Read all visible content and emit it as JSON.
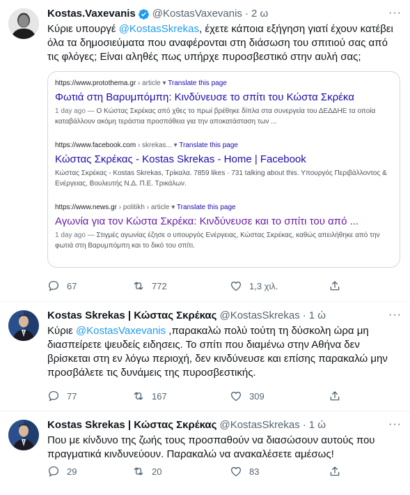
{
  "tweets": [
    {
      "name": "Kostas.Vaxevanis",
      "handle": "@KostasVaxevanis",
      "dot": "·",
      "time": "2 ω",
      "text_before": "Κύριε υπουργέ ",
      "mention": "@KostasSkrekas",
      "text_after": ", έχετε κάποια εξήγηση γιατί έχουν κατέβει όλα τα δημοσιεύματα που αναφέρονται στη διάσωση του σπιτιού σας από τις φλόγες; Είναι αληθές πως υπήρχε πυροσβεστικό στην αυλή σας;",
      "replies": "67",
      "retweets": "772",
      "likes": "1,3 χιλ."
    },
    {
      "name": "Kostas Skrekas | Κώστας Σκρέκας",
      "handle": "@KostasSkrekas",
      "dot": "·",
      "time": "1 ώ",
      "text_before": "Κύριε ",
      "mention": "@KostasVaxevanis",
      "text_after": " ,παρακαλώ πολύ τούτη τη δύσκολη ώρα μη διασπείρετε ψευδείς ειδησεις. Το σπίτι που διαμένω στην Αθήνα δεν βρίσκεται στη εν λόγω περιοχή, δεν κινδύνευσε και επίσης παρακαλώ μην προσβάλετε τις δυνάμεις της πυροσβεστικής.",
      "replies": "77",
      "retweets": "167",
      "likes": "309"
    },
    {
      "name": "Kostas Skrekas | Κώστας Σκρέκας",
      "handle": "@KostasSkrekas",
      "dot": "·",
      "time": "1 ώ",
      "text": "Που με κίνδυνο της ζωής τους προσπαθούν να διασώσουν αυτούς που πραγματικά κινδυνεύουν. Παρακαλώ να ανακαλέσετε αμέσως!",
      "replies": "29",
      "retweets": "20",
      "likes": "83"
    }
  ],
  "card": {
    "results": [
      {
        "url": "https://www.protothema.gr",
        "path": " › article",
        "translate": "Translate this page",
        "title": "Φωτιά στη Βαρυμπόμπη: Κινδύνευσε το σπίτι του Κώστα Σκρέκα",
        "snippet_date": "1 day ago —",
        "snippet": " Ο Κώστας Σκρέκας από χθες το πρωί βρέθηκε δίπλα στα συνεργεία του ΔΕΔΔΗΕ τα οποία καταβάλλουν ακόμη τεράστια προσπάθεια για την αποκατάσταση των ..."
      },
      {
        "url": "https://www.facebook.com",
        "path": " › skrekas...",
        "translate": "Translate this page",
        "title": "Κώστας Σκρέκας - Kostas Skrekas - Home | Facebook",
        "snippet_date": "",
        "snippet": "Κώστας Σκρέκας - Kostas Skrekas, Τρίκαλα. 7859 likes · 731 talking about this. Υπουργός Περιβάλλοντος & Ενέργειας, Βουλευτής Ν.Δ. Π.Ε. Τρικάλων."
      },
      {
        "url": "https://www.news.gr",
        "path": " › politikh › article",
        "translate": "Translate this page",
        "title": "Αγωνία για τον Κώστα Σκρέκα: Κινδύνευσε και το σπίτι του από ...",
        "snippet_date": "1 day ago —",
        "snippet": " Στιγμές αγωνίας έζησε ο υπουργός Ενέργειας, Κώστας Σκρέκας, καθώς απειλήθηκε από την φωτιά στη Βαρυμπόμπη και το δικό του σπίτι."
      }
    ]
  },
  "icons": {
    "reply": "reply-icon",
    "retweet": "retweet-icon",
    "like": "heart-icon",
    "share": "share-icon",
    "verified": "verified-badge-icon",
    "more": "more-icon"
  },
  "colors": {
    "accent": "#1d9bf0",
    "text": "#0f1419",
    "secondary": "#536471",
    "link": "#1a0dab",
    "visited": "#681da8"
  }
}
